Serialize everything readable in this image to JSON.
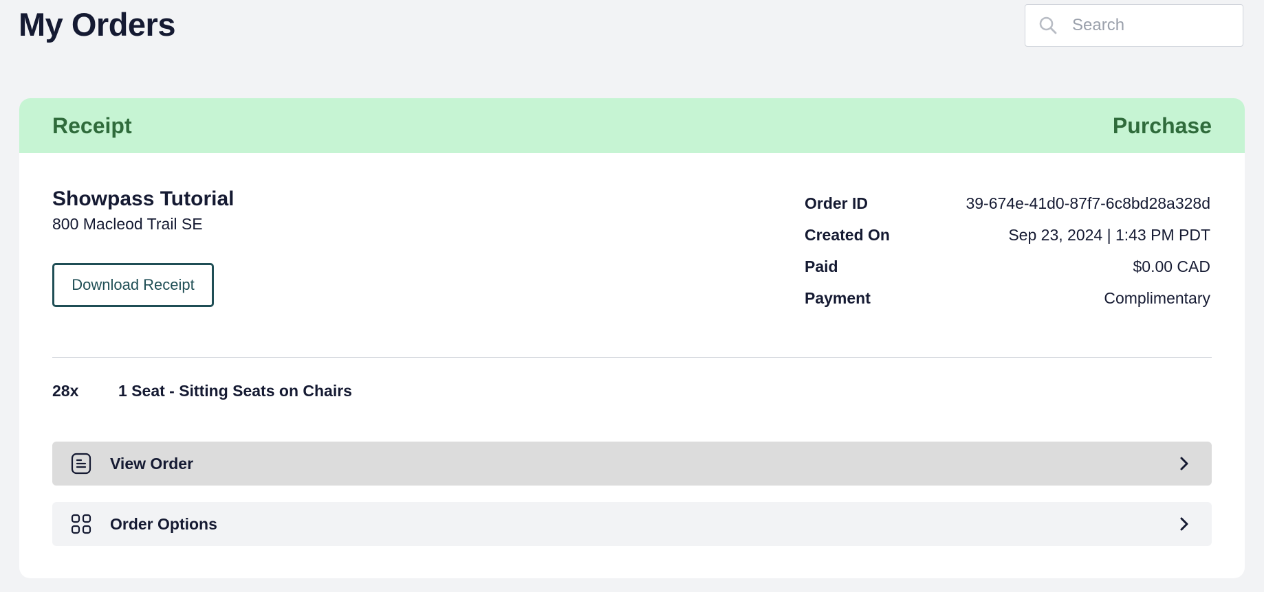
{
  "page": {
    "title": "My Orders"
  },
  "search": {
    "placeholder": "Search",
    "icon": "search-icon"
  },
  "order_card": {
    "header_left": "Receipt",
    "header_right": "Purchase",
    "header_color": "#c6f4d3",
    "event_title": "Showpass Tutorial",
    "address": "800 Macleod Trail SE",
    "download_label": "Download Receipt",
    "details": [
      {
        "label": "Order ID",
        "value": "39-674e-41d0-87f7-6c8bd28a328d"
      },
      {
        "label": "Created On",
        "value": "Sep 23, 2024 | 1:43 PM PDT"
      },
      {
        "label": "Paid",
        "value": "$0.00 CAD"
      },
      {
        "label": "Payment",
        "value": "Complimentary"
      }
    ],
    "line_item": {
      "quantity": "28x",
      "description": "1 Seat - Sitting Seats on Chairs"
    },
    "actions": [
      {
        "label": "View Order",
        "icon": "receipt-list-icon"
      },
      {
        "label": "Order Options",
        "icon": "grid-icon"
      }
    ]
  }
}
